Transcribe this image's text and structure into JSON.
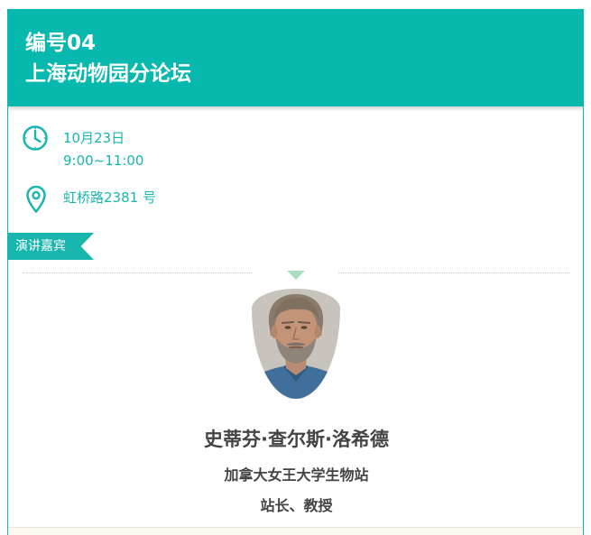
{
  "header": {
    "number": "编号04",
    "title": "上海动物园分论坛"
  },
  "schedule": {
    "date": "10月23日",
    "time": "9:00~11:00",
    "address": "虹桥路2381 号"
  },
  "speakers_tag": "演讲嘉宾",
  "speaker": {
    "name": "史蒂芬·查尔斯·洛希德",
    "organization": "加拿大女王大学生物站",
    "position": "站长、教授"
  },
  "colors": {
    "accent": "#07b8ae",
    "text_dark": "#444444",
    "arrow": "#a9dfc0"
  },
  "icons": {
    "time": "clock-icon",
    "location": "map-pin-icon"
  }
}
